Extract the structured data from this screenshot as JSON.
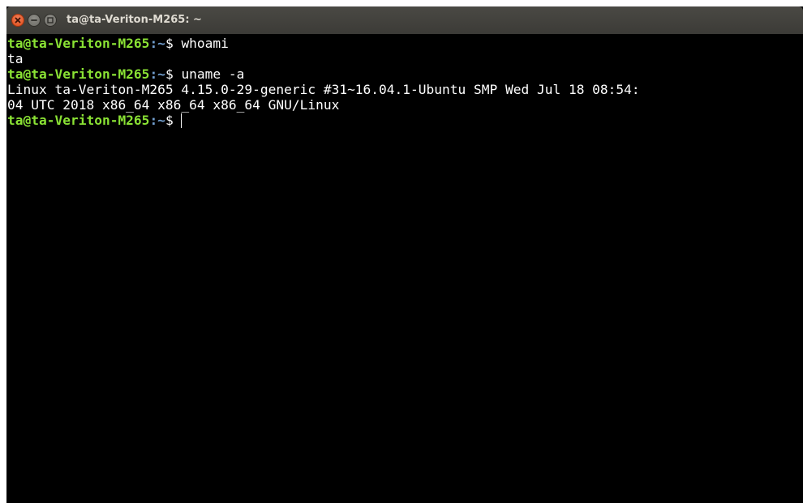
{
  "window": {
    "title": "ta@ta-Veriton-M265: ~",
    "colors": {
      "background": "#000000",
      "prompt_user": "#8ae234",
      "prompt_path": "#729fcf",
      "text": "#ffffff",
      "titlebar": "#3c3b37",
      "close_button": "#df4b16"
    },
    "icons": [
      "close-icon",
      "minimize-icon",
      "maximize-icon"
    ]
  },
  "terminal": {
    "prompt": {
      "user_host": "ta@ta-Veriton-M265",
      "path": ":~",
      "sign": "$ "
    },
    "commands": {
      "cmd1": "whoami",
      "cmd2": "uname -a"
    },
    "outputs": {
      "out1": "ta",
      "out2_line1": "Linux ta-Veriton-M265 4.15.0-29-generic #31~16.04.1-Ubuntu SMP Wed Jul 18 08:54:",
      "out2_line2": "04 UTC 2018 x86_64 x86_64 x86_64 GNU/Linux"
    }
  }
}
